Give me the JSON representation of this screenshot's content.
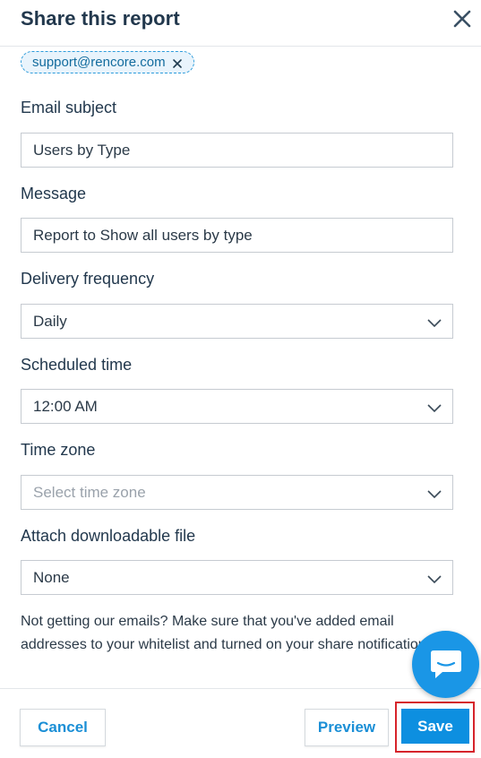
{
  "dialog": {
    "title": "Share this report"
  },
  "recipients": [
    {
      "email": "support@rencore.com"
    }
  ],
  "fields": {
    "email_subject": {
      "label": "Email subject",
      "value": "Users by Type"
    },
    "message": {
      "label": "Message",
      "value": "Report to Show all users by type"
    },
    "delivery_frequency": {
      "label": "Delivery frequency",
      "value": "Daily"
    },
    "scheduled_time": {
      "label": "Scheduled time",
      "value": "12:00 AM"
    },
    "time_zone": {
      "label": "Time zone",
      "placeholder": "Select time zone"
    },
    "attach_file": {
      "label": "Attach downloadable file",
      "value": "None"
    }
  },
  "note": {
    "line1": "Not getting our emails? Make sure that you've added email",
    "line2": "addresses to your whitelist and turned on your share notifications."
  },
  "footer": {
    "cancel_label": "Cancel",
    "preview_label": "Preview",
    "save_label": "Save"
  },
  "icons": {
    "close": "close-icon",
    "chip_remove": "close-icon",
    "dropdown": "chevron-down-icon",
    "chat": "chat-bubble-icon"
  },
  "colors": {
    "accent": "#0d8fe0",
    "highlight": "#d6242b",
    "title": "#22384d"
  }
}
